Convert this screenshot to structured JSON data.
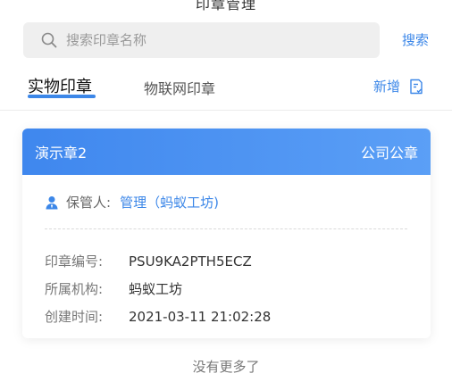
{
  "page": {
    "title": "印章管理"
  },
  "search": {
    "placeholder": "搜索印章名称",
    "value": "",
    "button_label": "搜索"
  },
  "tabs": [
    {
      "label": "实物印章",
      "active": true
    },
    {
      "label": "物联网印章",
      "active": false
    }
  ],
  "add": {
    "label": "新增"
  },
  "seal_card": {
    "name": "演示章2",
    "type": "公司公章",
    "keeper_label": "保管人:",
    "keeper_value": "管理（蚂蚁工坊)",
    "fields": [
      {
        "label": "印章编号:",
        "value": "PSU9KA2PTH5ECZ"
      },
      {
        "label": "所属机构:",
        "value": "蚂蚁工坊"
      },
      {
        "label": "创建时间:",
        "value": "2021-03-11 21:02:28"
      }
    ]
  },
  "footer": {
    "no_more": "没有更多了"
  },
  "colors": {
    "accent": "#3c87e8",
    "header_gradient_start": "#3f87ee",
    "header_gradient_end": "#5b9ff6"
  }
}
